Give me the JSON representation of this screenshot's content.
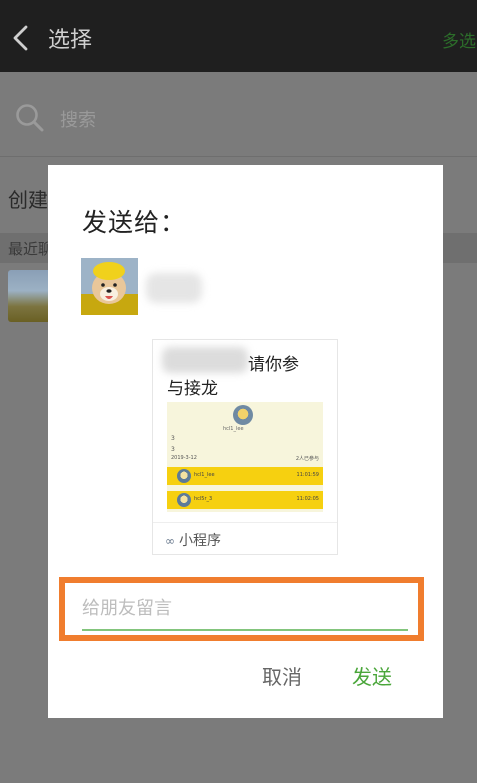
{
  "header": {
    "title": "选择",
    "multi_select": "多选"
  },
  "search": {
    "placeholder": "搜索"
  },
  "list": {
    "create_label": "创建",
    "recent_label": "最近聊"
  },
  "dialog": {
    "title": "发送给：",
    "card": {
      "title_line1": "请你参",
      "title_line2": "与接龙",
      "preview": {
        "avatar_name": "hcl1_lee",
        "line_a": "3",
        "line_b": "3",
        "date": "2019-3-12",
        "count": "2人已参与",
        "rows": [
          {
            "name": "hcl1_lee",
            "time": "11:01:59"
          },
          {
            "name": "hcl5r_3",
            "time": "11:02:05"
          }
        ]
      },
      "footer": "小程序"
    },
    "message": {
      "placeholder": "给朋友留言",
      "value": ""
    },
    "cancel_label": "取消",
    "send_label": "发送"
  },
  "colors": {
    "accent_green": "#4aa63a",
    "highlight_orange": "#f07d2e",
    "overlay": "#7b7b7b"
  }
}
